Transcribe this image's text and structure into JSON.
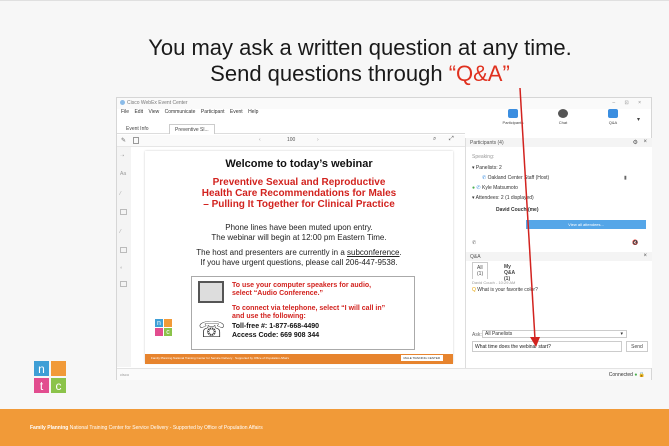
{
  "slide": {
    "title_line1": "You may ask a written question at any time.",
    "title_line2_prefix": "Send questions through ",
    "title_line2_highlight": "“Q&A”",
    "footer_bold": "Family Planning",
    "footer_rest": " National Training Center for Service Delivery - Supported by Office of Population Affairs",
    "logo_letters": [
      "n",
      "t",
      "c"
    ],
    "colors": {
      "footer_bar": "#f19a38",
      "accent_red": "#e0301e",
      "arrow": "#d2231f"
    }
  },
  "window": {
    "title": "Cisco WebEx Event Center",
    "controls": "– ⊡ ×",
    "menu": [
      "File",
      "Edit",
      "View",
      "Communicate",
      "Participant",
      "Event",
      "Help"
    ],
    "top_icons": [
      {
        "label": "Participants",
        "icon": "participants-icon",
        "color": "#3b8ee0"
      },
      {
        "label": "Chat",
        "icon": "chat-icon",
        "color": "#555555"
      },
      {
        "label": "Q&A",
        "icon": "qa-icon",
        "color": "#3b8ee0"
      }
    ],
    "tabs": [
      "Event Info",
      "Preventive Sl..."
    ],
    "zoom": "100",
    "status": "Connected",
    "brand": "cisco"
  },
  "document": {
    "heading": "Welcome to today’s webinar",
    "red1": "Preventive Sexual and Reproductive",
    "red2": "Health Care Recommendations for Males",
    "red3": "– Pulling It Together for Clinical Practice",
    "line1": "Phone lines have been muted upon entry.",
    "line2": "The webinar will begin at 12:00 pm Eastern Time.",
    "line3_prefix": "The host and presenters are currently in a ",
    "line3_link": "subconference",
    "line3_suffix": ".",
    "line4": "If you have urgent questions, please call 206-447-9538.",
    "audio1": "To use your computer speakers for audio,",
    "audio2": "select “Audio Conference.”",
    "tel1": "To connect via telephone, select “I will call in”",
    "tel2": "and use the following:",
    "tollfree": "Toll-free #: 1-877-668-4490",
    "access": "Access Code: 669 908 344",
    "footer": "Family Planning National Training Center for Service Delivery · Supported by Office of Population Affairs",
    "footer_logo": "MALE TRAINING CENTER"
  },
  "participants": {
    "header": "Participants (4)",
    "speaking": "Speaking:",
    "panelists": "Panelists: 2",
    "panelist1": "Oakland Center Staff (Host)",
    "panelist2": "Kyle Matsumoto",
    "attendees": "Attendees: 2 (1 displayed)",
    "attendee1": "David Couch (me)",
    "view_all": "View all attendees..."
  },
  "qa": {
    "header": "Q&A",
    "tab_all": "All (1)",
    "tab_my": "My Q&A (1)",
    "q_meta": "David Couch - 10:29 AM",
    "q_text": "What is your favorite color?",
    "ask_label": "Ask:",
    "ask_target": "All Panelists",
    "input_value": "What time does the webinar start?",
    "send": "Send"
  }
}
